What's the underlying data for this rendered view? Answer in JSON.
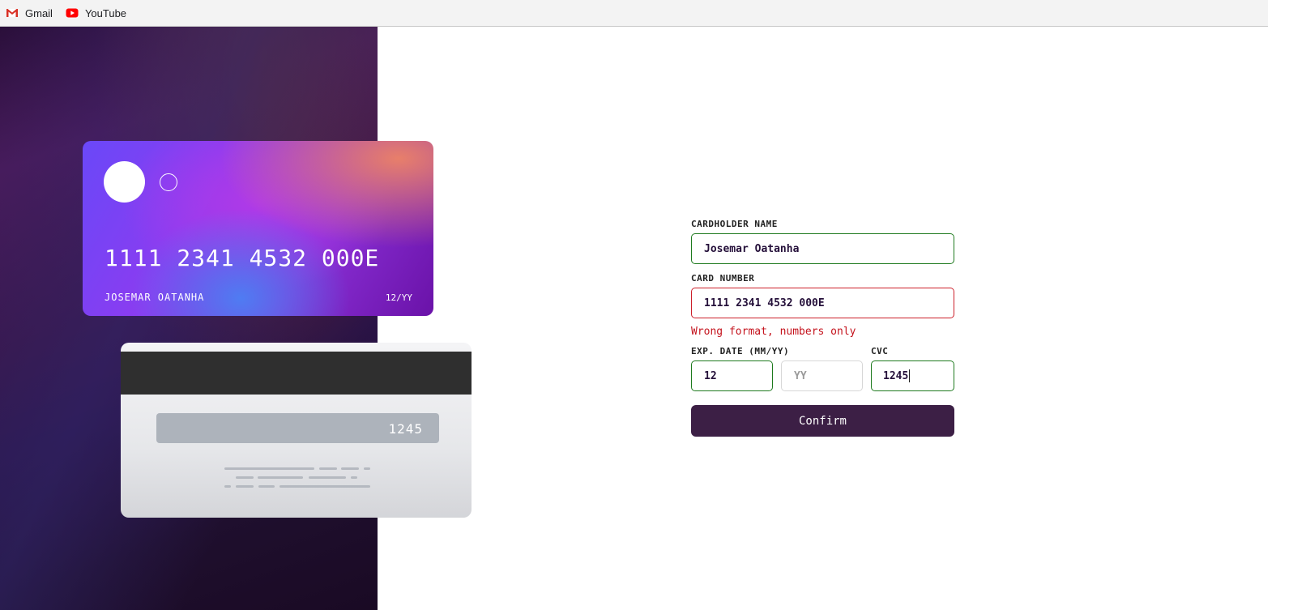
{
  "bookmarks": [
    {
      "label": "Gmail",
      "icon": "gmail-icon"
    },
    {
      "label": "YouTube",
      "icon": "youtube-icon"
    }
  ],
  "card_front": {
    "number": "1111 2341 4532 000E",
    "name": "JOSEMAR OATANHA",
    "expiry": "12/YY"
  },
  "card_back": {
    "cvc": "1245"
  },
  "form": {
    "name_label": "CARDHOLDER NAME",
    "name_value": "Josemar Oatanha",
    "number_label": "CARD NUMBER",
    "number_value": "1111 2341 4532 000E",
    "number_error": "Wrong format, numbers only",
    "exp_label": "EXP. DATE (MM/YY)",
    "month_value": "12",
    "year_placeholder": "YY",
    "cvc_label": "CVC",
    "cvc_value": "1245",
    "confirm_label": "Confirm"
  },
  "colors": {
    "valid_border": "#1e7a1e",
    "error_border": "#cc1f2a",
    "error_text": "#c4131d",
    "button_bg": "#3c1f45"
  }
}
